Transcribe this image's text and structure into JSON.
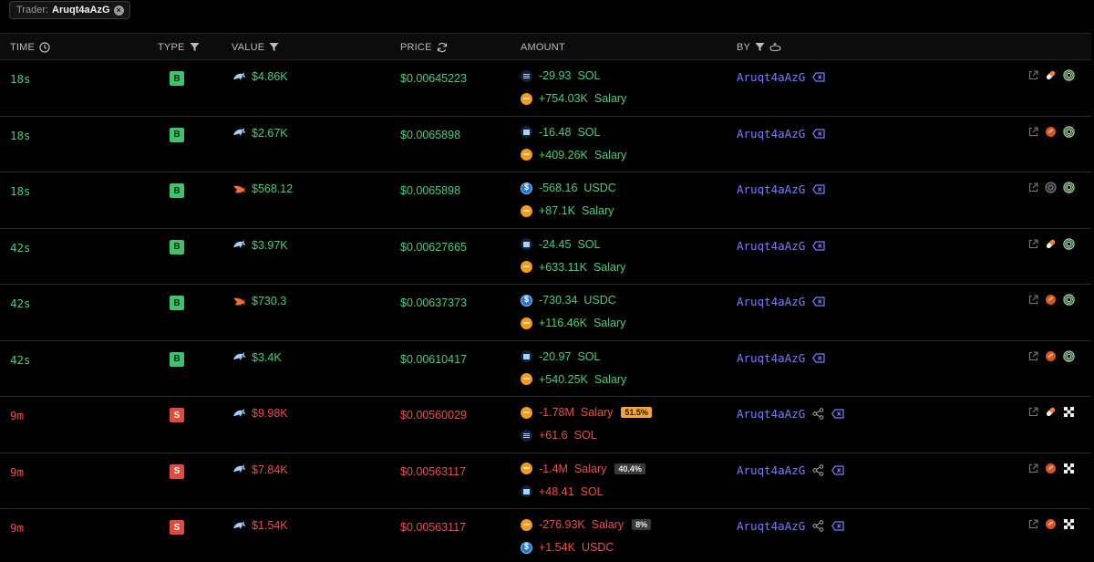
{
  "filter": {
    "prefix": "Trader:",
    "value": "Aruqt4aAzG"
  },
  "columns": {
    "time": "TIME",
    "type": "TYPE",
    "value": "VALUE",
    "price": "PRICE",
    "amount": "AMOUNT",
    "by": "BY"
  },
  "colors": {
    "buy": "#3fd17a",
    "sell": "#ef4b4b",
    "maker": "#7b7cff"
  },
  "rows": [
    {
      "time": "18s",
      "type": "B",
      "side": "buy",
      "value": "$4.86K",
      "value_icon": "dolphin-icon",
      "price": "$0.00645223",
      "amount1": {
        "qty": "-29.93",
        "token": "SOL",
        "icon": "sol"
      },
      "amount2": {
        "qty": "+754.03K",
        "token": "Salary",
        "icon": "salary"
      },
      "pct": "",
      "maker": "Aruqt4aAzG",
      "share": false
    },
    {
      "time": "18s",
      "type": "B",
      "side": "buy",
      "value": "$2.67K",
      "value_icon": "dolphin-icon",
      "price": "$0.0065898",
      "amount1": {
        "qty": "-16.48",
        "token": "SOL",
        "icon": "sol"
      },
      "amount2": {
        "qty": "+409.26K",
        "token": "Salary",
        "icon": "salary"
      },
      "pct": "",
      "maker": "Aruqt4aAzG",
      "share": false
    },
    {
      "time": "18s",
      "type": "B",
      "side": "buy",
      "value": "$568.12",
      "value_icon": "fish-icon",
      "price": "$0.0065898",
      "amount1": {
        "qty": "-568.16",
        "token": "USDC",
        "icon": "usdc"
      },
      "amount2": {
        "qty": "+87.1K",
        "token": "Salary",
        "icon": "salary"
      },
      "pct": "",
      "maker": "Aruqt4aAzG",
      "share": false
    },
    {
      "time": "42s",
      "type": "B",
      "side": "buy",
      "value": "$3.97K",
      "value_icon": "dolphin-icon",
      "price": "$0.00627665",
      "amount1": {
        "qty": "-24.45",
        "token": "SOL",
        "icon": "sol"
      },
      "amount2": {
        "qty": "+633.11K",
        "token": "Salary",
        "icon": "salary"
      },
      "pct": "",
      "maker": "Aruqt4aAzG",
      "share": false
    },
    {
      "time": "42s",
      "type": "B",
      "side": "buy",
      "value": "$730.3",
      "value_icon": "fish-icon",
      "price": "$0.00637373",
      "amount1": {
        "qty": "-730.34",
        "token": "USDC",
        "icon": "usdc"
      },
      "amount2": {
        "qty": "+116.46K",
        "token": "Salary",
        "icon": "salary"
      },
      "pct": "",
      "maker": "Aruqt4aAzG",
      "share": false
    },
    {
      "time": "42s",
      "type": "B",
      "side": "buy",
      "value": "$3.4K",
      "value_icon": "dolphin-icon",
      "price": "$0.00610417",
      "amount1": {
        "qty": "-20.97",
        "token": "SOL",
        "icon": "sol"
      },
      "amount2": {
        "qty": "+540.25K",
        "token": "Salary",
        "icon": "salary"
      },
      "pct": "",
      "maker": "Aruqt4aAzG",
      "share": false
    },
    {
      "time": "9m",
      "type": "S",
      "side": "sell",
      "value": "$9.98K",
      "value_icon": "dolphin-icon",
      "price": "$0.00560029",
      "amount1": {
        "qty": "-1.78M",
        "token": "Salary",
        "icon": "salary"
      },
      "amount2": {
        "qty": "+61.6",
        "token": "SOL",
        "icon": "sol"
      },
      "pct": "51.5%",
      "pct_style": "orange",
      "maker": "Aruqt4aAzG",
      "share": true
    },
    {
      "time": "9m",
      "type": "S",
      "side": "sell",
      "value": "$7.84K",
      "value_icon": "dolphin-icon",
      "price": "$0.00563117",
      "amount1": {
        "qty": "-1.4M",
        "token": "Salary",
        "icon": "salary"
      },
      "amount2": {
        "qty": "+48.41",
        "token": "SOL",
        "icon": "sol"
      },
      "pct": "40.4%",
      "pct_style": "gray",
      "maker": "Aruqt4aAzG",
      "share": true
    },
    {
      "time": "9m",
      "type": "S",
      "side": "sell",
      "value": "$1.54K",
      "value_icon": "dolphin-icon",
      "price": "$0.00563117",
      "amount1": {
        "qty": "-276.93K",
        "token": "Salary",
        "icon": "salary"
      },
      "amount2": {
        "qty": "+1.54K",
        "token": "USDC",
        "icon": "usdc"
      },
      "pct": "8%",
      "pct_style": "gray",
      "maker": "Aruqt4aAzG",
      "share": true
    }
  ]
}
